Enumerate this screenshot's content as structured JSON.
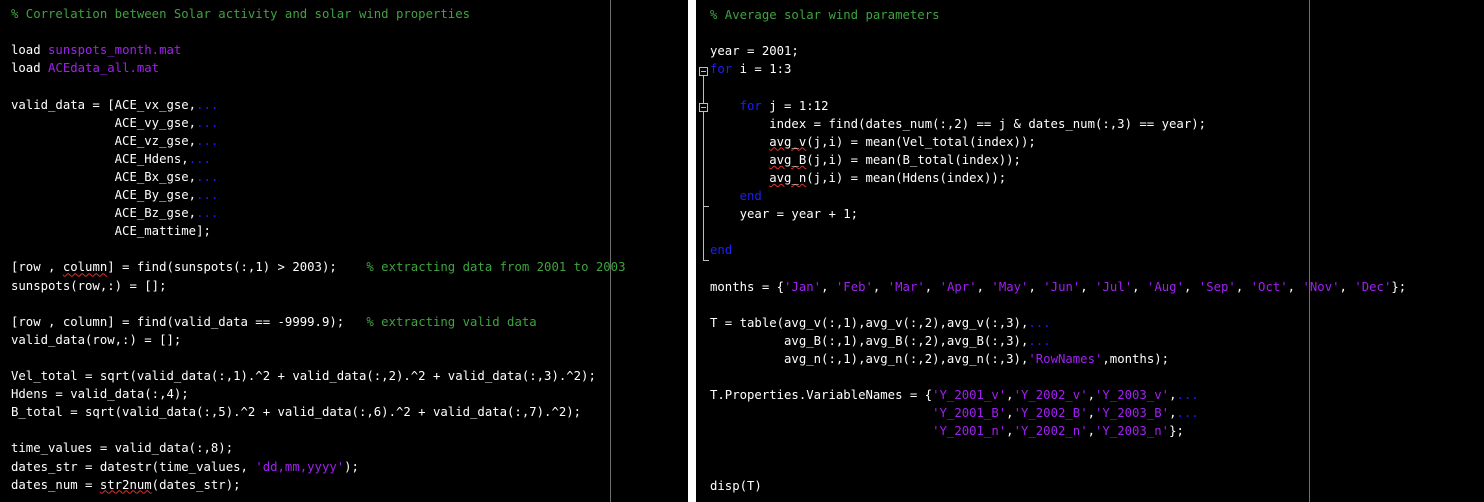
{
  "colors": {
    "background": "#000000",
    "default": "#ffffff",
    "comment": "#3fa33f",
    "string": "#a020f0",
    "keyword": "#1d1dff",
    "continuation": "#1d1dff",
    "edge_line": "#6e6e6e"
  },
  "left_editor": {
    "lines": [
      [
        [
          "comment",
          "% Correlation between Solar activity and solar wind properties"
        ]
      ],
      [],
      [
        [
          "default",
          "load "
        ],
        [
          "string",
          "sunspots_month.mat"
        ]
      ],
      [
        [
          "default",
          "load "
        ],
        [
          "string",
          "ACEdata_all.mat"
        ]
      ],
      [],
      [
        [
          "default",
          "valid_data = [ACE_vx_gse,"
        ],
        [
          "continuation",
          "..."
        ]
      ],
      [
        [
          "default",
          "              ACE_vy_gse,"
        ],
        [
          "continuation",
          "..."
        ]
      ],
      [
        [
          "default",
          "              ACE_vz_gse,"
        ],
        [
          "continuation",
          "..."
        ]
      ],
      [
        [
          "default",
          "              ACE_Hdens,"
        ],
        [
          "continuation",
          "..."
        ]
      ],
      [
        [
          "default",
          "              ACE_Bx_gse,"
        ],
        [
          "continuation",
          "..."
        ]
      ],
      [
        [
          "default",
          "              ACE_By_gse,"
        ],
        [
          "continuation",
          "..."
        ]
      ],
      [
        [
          "default",
          "              ACE_Bz_gse,"
        ],
        [
          "continuation",
          "..."
        ]
      ],
      [
        [
          "default",
          "              ACE_mattime];"
        ]
      ],
      [],
      [
        [
          "default",
          "[row , "
        ],
        [
          "squiggle",
          "column"
        ],
        [
          "default",
          "] = find(sunspots(:,1) > 2003);    "
        ],
        [
          "comment",
          "% extracting data from 2001 to 2003"
        ]
      ],
      [
        [
          "default",
          "sunspots(row,:) = [];"
        ]
      ],
      [],
      [
        [
          "default",
          "[row , column] = find(valid_data == -9999.9);   "
        ],
        [
          "comment",
          "% extracting valid data"
        ]
      ],
      [
        [
          "default",
          "valid_data(row,:) = [];"
        ]
      ],
      [],
      [
        [
          "default",
          "Vel_total = sqrt(valid_data(:,1).^2 + valid_data(:,2).^2 + valid_data(:,3).^2);"
        ]
      ],
      [
        [
          "default",
          "Hdens = valid_data(:,4);"
        ]
      ],
      [
        [
          "default",
          "B_total = sqrt(valid_data(:,5).^2 + valid_data(:,6).^2 + valid_data(:,7).^2);"
        ]
      ],
      [],
      [
        [
          "default",
          "time_values = valid_data(:,8);"
        ]
      ],
      [
        [
          "default",
          "dates_str = datestr(time_values, "
        ],
        [
          "string",
          "'dd,mm,yyyy'"
        ],
        [
          "default",
          ");"
        ]
      ],
      [
        [
          "default",
          "dates_num = "
        ],
        [
          "squiggle",
          "str2num"
        ],
        [
          "default",
          "(dates_str);"
        ]
      ]
    ]
  },
  "right_editor": {
    "lines": [
      [
        [
          "comment",
          "% Average solar wind parameters"
        ]
      ],
      [],
      [
        [
          "default",
          "year = 2001;"
        ]
      ],
      [
        [
          "keyword",
          "for"
        ],
        [
          "default",
          " i = 1:3"
        ]
      ],
      [],
      [
        [
          "default",
          "    "
        ],
        [
          "keyword",
          "for"
        ],
        [
          "default",
          " j = 1:12"
        ]
      ],
      [
        [
          "default",
          "        index = find(dates_num(:,2) == j & dates_num(:,3) == year);"
        ]
      ],
      [
        [
          "default",
          "        "
        ],
        [
          "squiggle",
          "avg_v"
        ],
        [
          "default",
          "(j,i) = mean(Vel_total(index));"
        ]
      ],
      [
        [
          "default",
          "        "
        ],
        [
          "squiggle",
          "avg_B"
        ],
        [
          "default",
          "(j,i) = mean(B_total(index));"
        ]
      ],
      [
        [
          "default",
          "        "
        ],
        [
          "squiggle",
          "avg_n"
        ],
        [
          "default",
          "(j,i) = mean(Hdens(index));"
        ]
      ],
      [
        [
          "default",
          "    "
        ],
        [
          "keyword",
          "end"
        ]
      ],
      [
        [
          "default",
          "    year = year + 1;"
        ]
      ],
      [],
      [
        [
          "keyword",
          "end"
        ]
      ],
      [],
      [
        [
          "default",
          "months = {"
        ],
        [
          "string",
          "'Jan'"
        ],
        [
          "default",
          ", "
        ],
        [
          "string",
          "'Feb'"
        ],
        [
          "default",
          ", "
        ],
        [
          "string",
          "'Mar'"
        ],
        [
          "default",
          ", "
        ],
        [
          "string",
          "'Apr'"
        ],
        [
          "default",
          ", "
        ],
        [
          "string",
          "'May'"
        ],
        [
          "default",
          ", "
        ],
        [
          "string",
          "'Jun'"
        ],
        [
          "default",
          ", "
        ],
        [
          "string",
          "'Jul'"
        ],
        [
          "default",
          ", "
        ],
        [
          "string",
          "'Aug'"
        ],
        [
          "default",
          ", "
        ],
        [
          "string",
          "'Sep'"
        ],
        [
          "default",
          ", "
        ],
        [
          "string",
          "'Oct'"
        ],
        [
          "default",
          ", "
        ],
        [
          "string",
          "'Nov'"
        ],
        [
          "default",
          ", "
        ],
        [
          "string",
          "'Dec'"
        ],
        [
          "default",
          "};"
        ]
      ],
      [],
      [
        [
          "default",
          "T = table(avg_v(:,1),avg_v(:,2),avg_v(:,3),"
        ],
        [
          "continuation",
          "..."
        ]
      ],
      [
        [
          "default",
          "          avg_B(:,1),avg_B(:,2),avg_B(:,3),"
        ],
        [
          "continuation",
          "..."
        ]
      ],
      [
        [
          "default",
          "          avg_n(:,1),avg_n(:,2),avg_n(:,3),"
        ],
        [
          "string",
          "'RowNames'"
        ],
        [
          "default",
          ",months);"
        ]
      ],
      [],
      [
        [
          "default",
          "T.Properties.VariableNames = {"
        ],
        [
          "string",
          "'Y_2001_v'"
        ],
        [
          "default",
          ","
        ],
        [
          "string",
          "'Y_2002_v'"
        ],
        [
          "default",
          ","
        ],
        [
          "string",
          "'Y_2003_v'"
        ],
        [
          "default",
          ","
        ],
        [
          "continuation",
          "..."
        ]
      ],
      [
        [
          "default",
          "                              "
        ],
        [
          "string",
          "'Y_2001_B'"
        ],
        [
          "default",
          ","
        ],
        [
          "string",
          "'Y_2002_B'"
        ],
        [
          "default",
          ","
        ],
        [
          "string",
          "'Y_2003_B'"
        ],
        [
          "default",
          ","
        ],
        [
          "continuation",
          "..."
        ]
      ],
      [
        [
          "default",
          "                              "
        ],
        [
          "string",
          "'Y_2001_n'"
        ],
        [
          "default",
          ","
        ],
        [
          "string",
          "'Y_2002_n'"
        ],
        [
          "default",
          ","
        ],
        [
          "string",
          "'Y_2003_n'"
        ],
        [
          "default",
          "};"
        ]
      ],
      [],
      [],
      [
        [
          "default",
          "disp(T)"
        ]
      ]
    ]
  }
}
